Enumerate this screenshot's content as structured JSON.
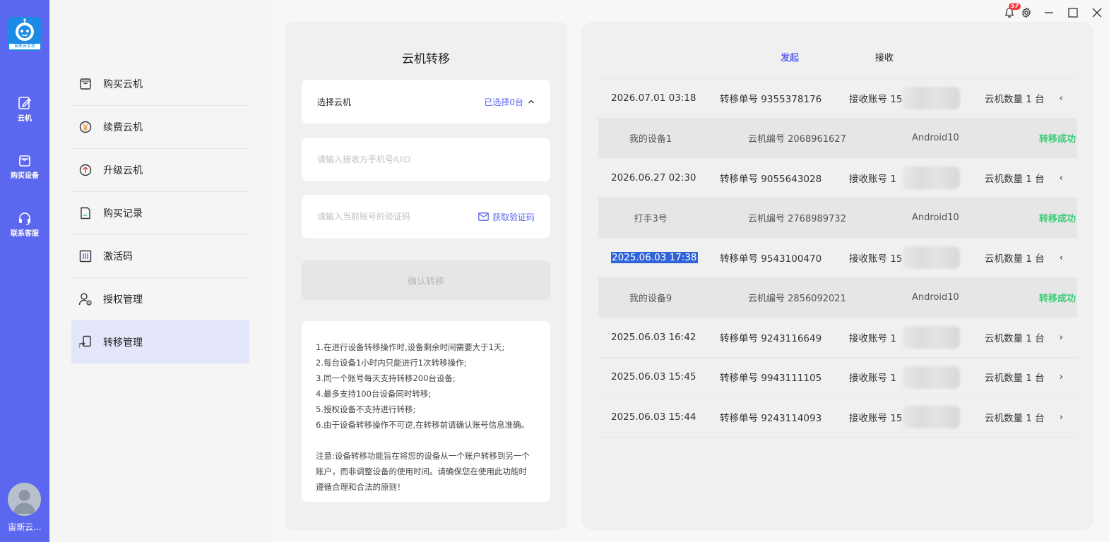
{
  "window": {
    "notification_count": "57"
  },
  "rail": {
    "logo_caption": "宙斯云手机",
    "items": [
      {
        "label": "云机",
        "icon": "cloud-edit-icon"
      },
      {
        "label": "购买设备",
        "icon": "shopping-bag-icon"
      },
      {
        "label": "联系客服",
        "icon": "headset-icon"
      }
    ],
    "user_name": "宙斯云..."
  },
  "menu": {
    "items": [
      {
        "label": "购买云机",
        "icon": "bag-icon"
      },
      {
        "label": "续费云机",
        "icon": "yen-circle-icon"
      },
      {
        "label": "升级云机",
        "icon": "up-arrow-circle-icon"
      },
      {
        "label": "购买记录",
        "icon": "document-icon"
      },
      {
        "label": "激活码",
        "icon": "barcode-icon"
      },
      {
        "label": "授权管理",
        "icon": "user-lock-icon"
      },
      {
        "label": "转移管理",
        "icon": "transfer-icon"
      }
    ],
    "active_index": 6
  },
  "transfer_form": {
    "title": "云机转移",
    "select_label": "选择云机",
    "selected_prefix": "已选择",
    "selected_count": "0",
    "selected_suffix": "台",
    "receiver_placeholder": "请输入接收方手机号/UID",
    "code_placeholder": "请输入当前账号的验证码",
    "get_code_label": "获取验证码",
    "confirm_label": "确认转移",
    "rules": [
      "1.在进行设备转移操作时,设备剩余时间需要大于1天;",
      "2.每台设备1小时内只能进行1次转移操作;",
      "3.同一个账号每天支持转移200台设备;",
      "4.最多支持100台设备同时转移;",
      "5.授权设备不支持进行转移;",
      "6.由于设备转移操作不可逆,在转移前请确认账号信息准确。"
    ],
    "notice_lines": [
      "注意:设备转移功能旨在将您的设备从一个账户转移到另一个",
      "账户，而非调整设备的使用时间。请确保您在使用此功能时",
      "遵循合理和合法的原则！"
    ]
  },
  "records": {
    "tabs": [
      {
        "label": "发起",
        "active": true
      },
      {
        "label": "接收",
        "active": false
      }
    ],
    "items": [
      {
        "datetime": "2026.07.01 03:18",
        "order": "转移单号 9355378176",
        "account": "接收账号 15",
        "count": "云机数量 1 台",
        "expanded": true,
        "chevron": "‹",
        "detail": {
          "device": "我的设备1",
          "cloud_id": "云机编号 2068961627",
          "os": "Android10",
          "status": "转移成功"
        }
      },
      {
        "datetime": "2026.06.27 02:30",
        "order": "转移单号 9055643028",
        "account": "接收账号 1",
        "count": "云机数量 1 台",
        "expanded": true,
        "chevron": "‹",
        "detail": {
          "device": "打手3号",
          "cloud_id": "云机编号 2768989732",
          "os": "Android10",
          "status": "转移成功"
        }
      },
      {
        "datetime": "2025.06.03 17:38",
        "order": "转移单号 9543100470",
        "account": "接收账号 15",
        "count": "云机数量 1 台",
        "expanded": true,
        "highlighted": true,
        "chevron": "‹",
        "detail": {
          "device": "我的设备9",
          "cloud_id": "云机编号 2856092021",
          "os": "Android10",
          "status": "转移成功"
        }
      },
      {
        "datetime": "2025.06.03 16:42",
        "order": "转移单号 9243116649",
        "account": "接收账号 1",
        "count": "云机数量 1 台",
        "expanded": false,
        "chevron": "›"
      },
      {
        "datetime": "2025.06.03 15:45",
        "order": "转移单号 9943111105",
        "account": "接收账号 1",
        "count": "云机数量 1 台",
        "expanded": false,
        "chevron": "›"
      },
      {
        "datetime": "2025.06.03 15:44",
        "order": "转移单号 9243114093",
        "account": "接收账号 15",
        "count": "云机数量 1 台",
        "expanded": false,
        "chevron": "›"
      }
    ]
  }
}
